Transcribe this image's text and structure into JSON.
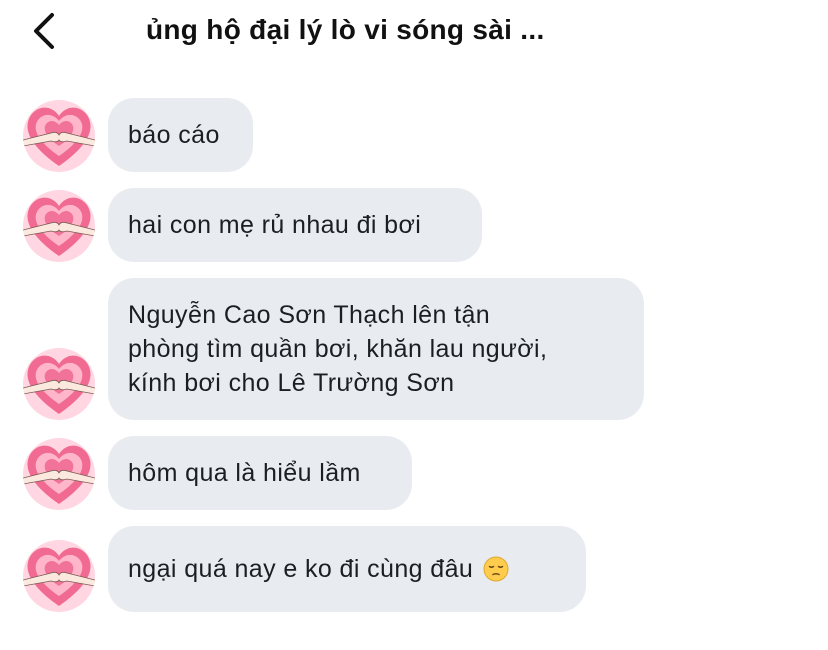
{
  "header": {
    "back_icon": "chevron-left-icon",
    "title": "ủng hộ đại lý lò vi sóng sài ..."
  },
  "avatar": {
    "icon": "heart-hands-avatar",
    "colors": {
      "background": "#ffd6e1",
      "heart_outer": "#f06a91",
      "heart_inner": "#ffb6cb",
      "heart_core": "#f27399",
      "hand": "#fbe9e0"
    }
  },
  "messages": [
    {
      "text": "báo cáo"
    },
    {
      "text": "hai con mẹ rủ nhau đi bơi"
    },
    {
      "text": "Nguyễn Cao Sơn Thạch lên tận\nphòng tìm quần bơi, khăn lau người,\nkính bơi cho Lê Trường Sơn"
    },
    {
      "text": "hôm qua là hiểu lầm"
    },
    {
      "text": "ngại quá nay e ko đi cùng đâu",
      "emoji": "pensive-face-emoji"
    }
  ],
  "colors": {
    "bubble": "#e8ecf1",
    "text": "#1c1e21"
  }
}
